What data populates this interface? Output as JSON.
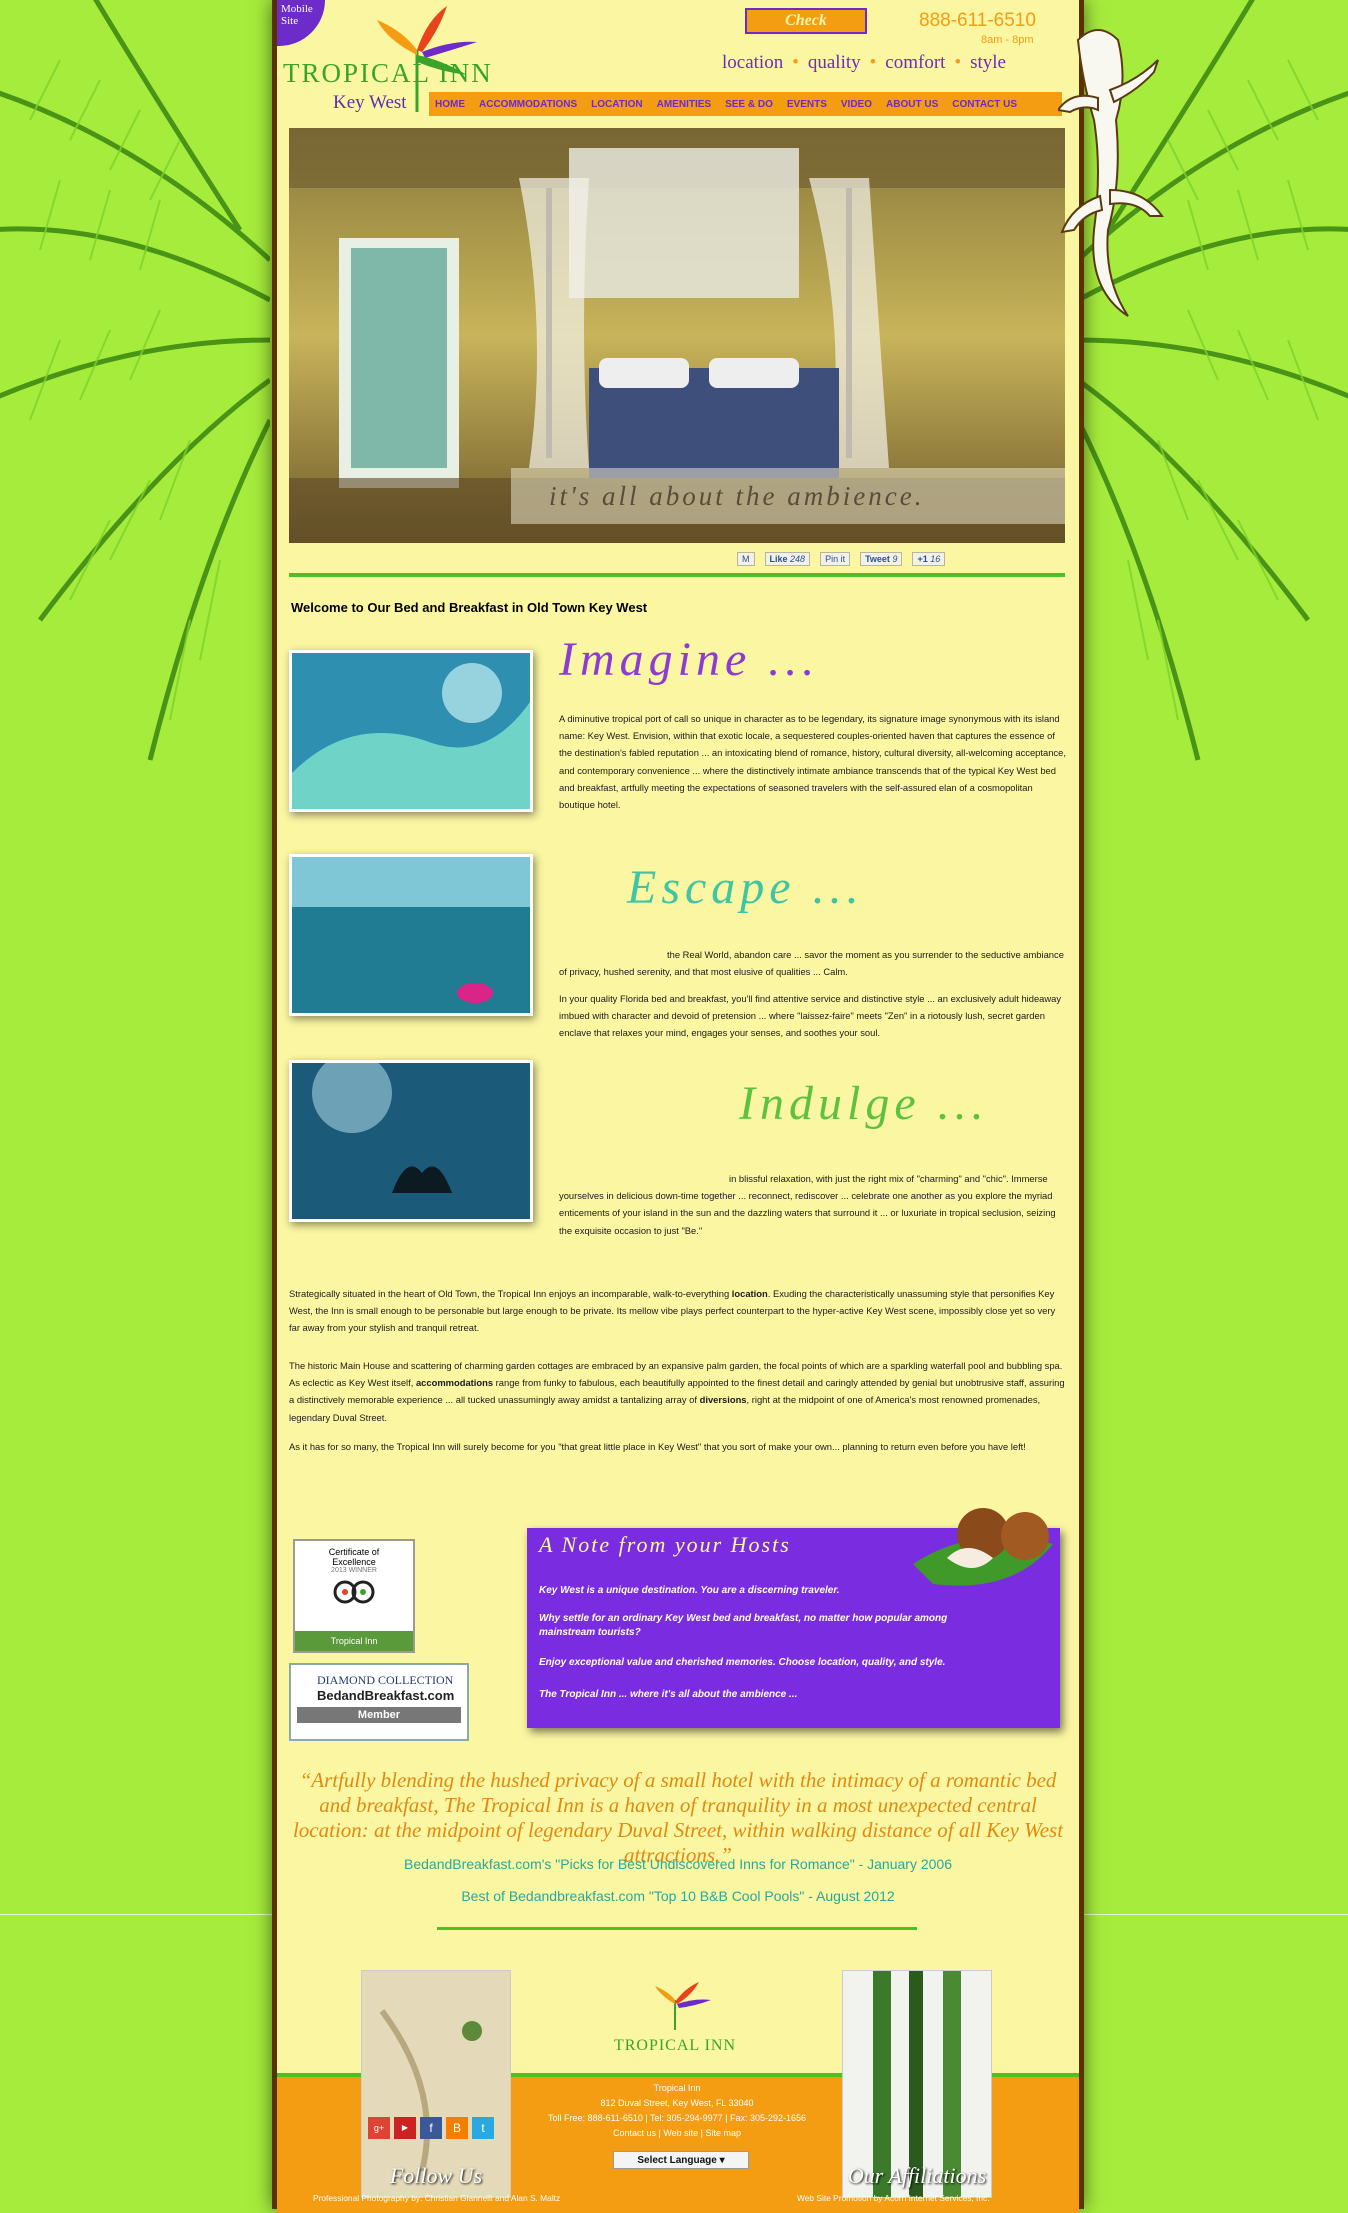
{
  "header": {
    "mobile_badge": "Mobile Site",
    "logo_name": "TROPICAL INN",
    "logo_city": "Key West",
    "check_availability": "Check Availability",
    "phone": "888-611-6510",
    "hours": "8am - 8pm",
    "tagline": [
      "location",
      "quality",
      "comfort",
      "style"
    ]
  },
  "nav": {
    "items": [
      "HOME",
      "ACCOMMODATIONS",
      "LOCATION",
      "AMENITIES",
      "SEE & DO",
      "EVENTS",
      "VIDEO",
      "ABOUT US",
      "CONTACT US"
    ]
  },
  "hero": {
    "caption": "it's all about the ambience."
  },
  "social": {
    "like": "Like",
    "like_count": "248",
    "pin": "Pin it",
    "tweet": "Tweet",
    "tweet_count": "9",
    "plus": "+1",
    "plus_count": "16"
  },
  "welcome": "Welcome to Our Bed and Breakfast in Old Town Key West",
  "sections": {
    "imagine": {
      "heading": "Imagine ...",
      "text": "A diminutive tropical port of call so unique in character as to be legendary, its signature image synonymous with its island name: Key West. Envision, within that exotic locale, a sequestered couples-oriented haven that captures the essence of the destination's fabled reputation ... an intoxicating blend of romance, history, cultural diversity, all-welcoming acceptance, and contemporary convenience ... where the distinctively intimate ambiance transcends that of the typical Key West bed and breakfast, artfully meeting the expectations of seasoned travelers with the self-assured elan of a cosmopolitan boutique hotel."
    },
    "escape": {
      "heading": "Escape ...",
      "text1": "the Real World, abandon care ... savor the moment as you surrender to the seductive ambiance of privacy, hushed serenity, and that most elusive of qualities ... Calm.",
      "text2": "In your quality Florida bed and breakfast, you'll find attentive service and distinctive style ... an exclusively adult hideaway imbued with character and devoid of pretension ... where \"laissez-faire\" meets \"Zen\" in a riotously lush, secret garden enclave that relaxes your mind, engages your senses, and soothes your soul."
    },
    "indulge": {
      "heading": "Indulge ...",
      "text": "in blissful relaxation, with just the right mix of \"charming\" and \"chic\". Immerse yourselves in delicious down-time together ... reconnect, rediscover ... celebrate one another as you explore the myriad enticements of your island in the sun and the dazzling waters that surround it ... or luxuriate in tropical seclusion, seizing the exquisite occasion to just \"Be.\""
    }
  },
  "body": {
    "p1_a": "Strategically situated in the heart of Old Town, the Tropical Inn enjoys an incomparable, walk-to-everything ",
    "p1_link": "location",
    "p1_b": ". Exuding the characteristically unassuming style that personifies Key West, the Inn is small enough to be personable but large enough to be private.  Its mellow vibe plays perfect counterpart to the hyper-active Key West scene, impossibly close yet so very far away from your stylish and tranquil retreat.",
    "p2_a": "The historic Main House and scattering of charming garden cottages are embraced by an expansive palm garden, the focal points of which are a sparkling waterfall pool and bubbling spa. As eclectic as Key West itself, ",
    "p2_link1": "accommodations",
    "p2_b": " range from funky to fabulous, each beautifully appointed to the finest detail and caringly attended by genial but unobtrusive staff, assuring a distinctively memorable experience ... all tucked unassumingly away amidst a tantalizing array of ",
    "p2_link2": "diversions",
    "p2_c": ", right at the midpoint of one of America's most renowned promenades, legendary Duval Street.",
    "p3": "As it has for so many, the Tropical Inn will surely become for you \"that great little place in Key West\" that you sort of make your own... planning to return even before you have left!"
  },
  "badges": {
    "cert_line1": "Certificate of",
    "cert_line2": "Excellence",
    "cert_line3": "2013 WINNER",
    "cert_name": "Tropical Inn",
    "dc_line1": "DIAMOND COLLECTION",
    "dc_line2": "BedandBreakfast.com",
    "dc_member": "Member"
  },
  "note": {
    "title": "A Note from your Hosts",
    "l1": "Key West is a unique destination.  You are a discerning traveler.",
    "l2": "Why settle for an ordinary Key West bed and breakfast, no matter how popular among mainstream tourists?",
    "l3": "Enjoy exceptional value and cherished memories.  Choose location, quality, and style.",
    "l4": "The Tropical Inn ... where it's all about the ambience ..."
  },
  "quote": {
    "text": "“Artfully blending the hushed privacy of a small hotel with the intimacy of a romantic bed and breakfast, The Tropical Inn is a haven of tranquility in a most unexpected central location: at the midpoint of legendary Duval Street, within walking distance of all Key West attractions.”",
    "source1": "BedandBreakfast.com's \"Picks for Best Undiscovered Inns for Romance\" - January 2006",
    "source2": "Best of Bedandbreakfast.com \"Top 10 B&B Cool Pools\" - August 2012"
  },
  "footer": {
    "follow": "Follow Us",
    "affiliations": "Our Affiliations",
    "logo_name": "TROPICAL INN",
    "name": "Tropical Inn",
    "address": "812 Duval Street, Key West, FL 33040",
    "phones": "Toll Free: 888-611-6510 | Tel: 305-294-9977 | Fax: 305-292-1656",
    "links": "Contact us | Web site | Site map",
    "language": "Select Language",
    "photo_credit": "Professional Photography by: Christian Giannelli and Alan S. Maltz",
    "promo_credit": "Web Site Promotion by Acorn Internet Services, Inc."
  },
  "colors": {
    "background": "#a6ec3c",
    "page": "#fbf6a2",
    "orange": "#f49c12",
    "purple": "#6d2bc9",
    "green": "#4cc026"
  }
}
